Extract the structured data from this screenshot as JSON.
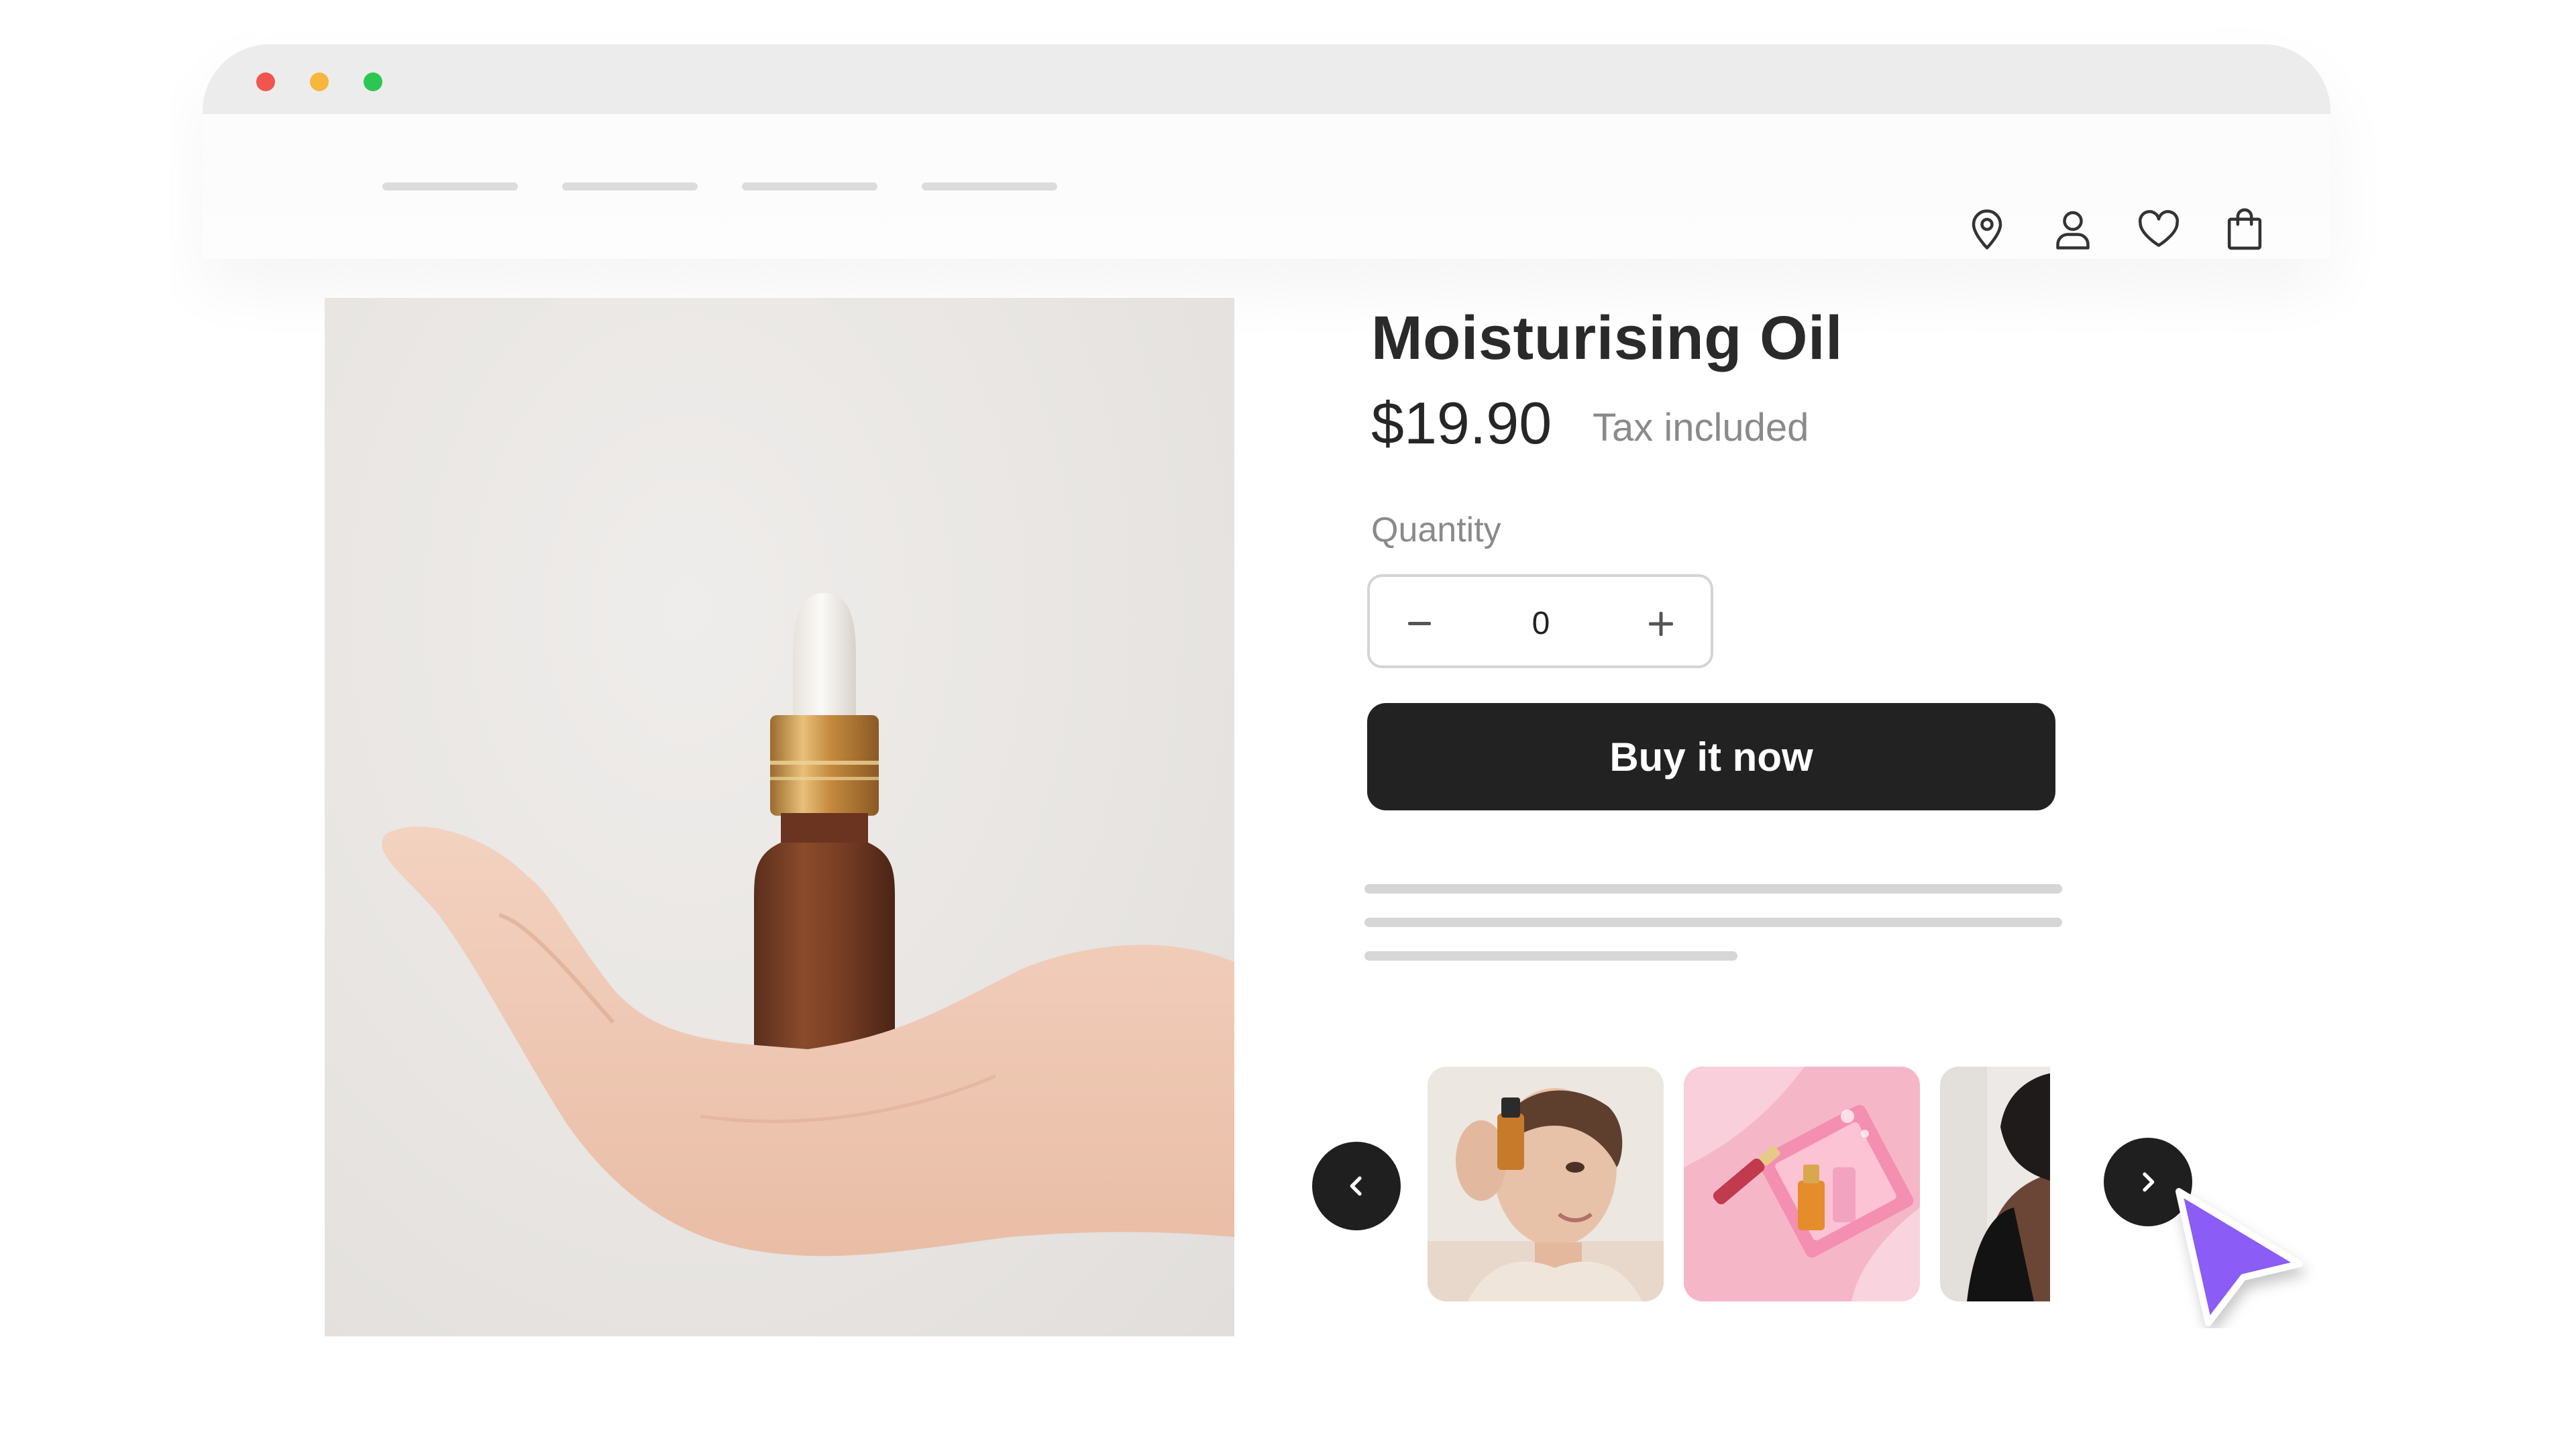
{
  "window": {
    "controls": [
      "close",
      "minimize",
      "maximize"
    ],
    "control_colors": {
      "close": "#ff5f57",
      "minimize": "#febc2e",
      "maximize": "#28c840"
    }
  },
  "header": {
    "nav_icons": [
      "location-pin-icon",
      "user-icon",
      "heart-icon",
      "shopping-bag-icon"
    ]
  },
  "product": {
    "title": "Moisturising Oil",
    "price": "$19.90",
    "tax_note": "Tax included",
    "quantity_label": "Quantity",
    "quantity_value": "0",
    "buy_label": "Buy it now"
  },
  "carousel": {
    "prev_icon": "chevron-left-icon",
    "next_icon": "chevron-right-icon",
    "thumbnails": [
      "woman-holding-serum",
      "pink-cosmetics-flatlay",
      "woman-profile"
    ]
  },
  "colors": {
    "accent": "#222222",
    "cursor": "#8b5cf6"
  }
}
